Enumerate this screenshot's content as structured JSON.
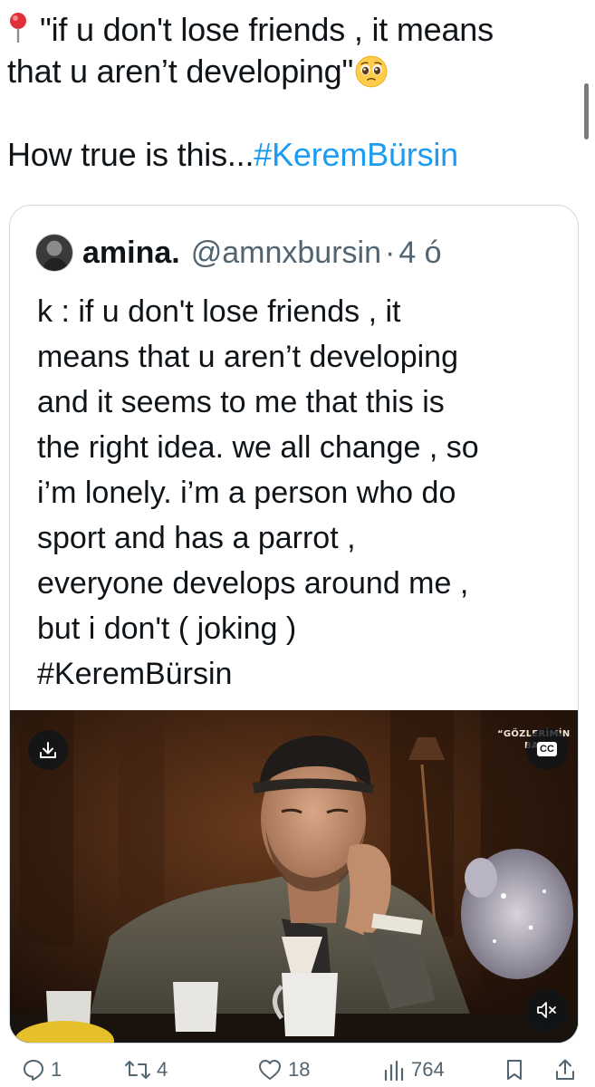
{
  "tweet": {
    "line1": "\"if u don't lose friends , it means",
    "line2": "that u aren’t developing\"",
    "line3_text": "How true is this...",
    "line3_hashtag": "#KeremBürsin",
    "pin_icon": "round-pushpin-icon",
    "emoji_icon": "pleading-face-icon"
  },
  "quote": {
    "name": "amina.",
    "handle": "@amnxbursin",
    "separator": "·",
    "time": "4 ó",
    "lines": [
      "k : if u don't lose friends , it",
      "means that u aren’t developing",
      "and it seems to me that this is",
      "the right idea. we all change , so",
      "i’m lonely. i’m a person who do",
      "sport and has a parrot ,",
      "everyone develops around me ,",
      "but i don't ( joking )"
    ],
    "hashtag": "#KeremBürsin",
    "video": {
      "watermark_line1": "“GÖZLERİMİN",
      "watermark_line2": "BAK,",
      "cc_label": "CC"
    }
  },
  "actions": {
    "replies": "1",
    "reposts": "4",
    "likes": "18",
    "views": "764"
  },
  "colors": {
    "link": "#1d9bf0",
    "secondary_text": "#536471",
    "border": "#cfd9de"
  }
}
